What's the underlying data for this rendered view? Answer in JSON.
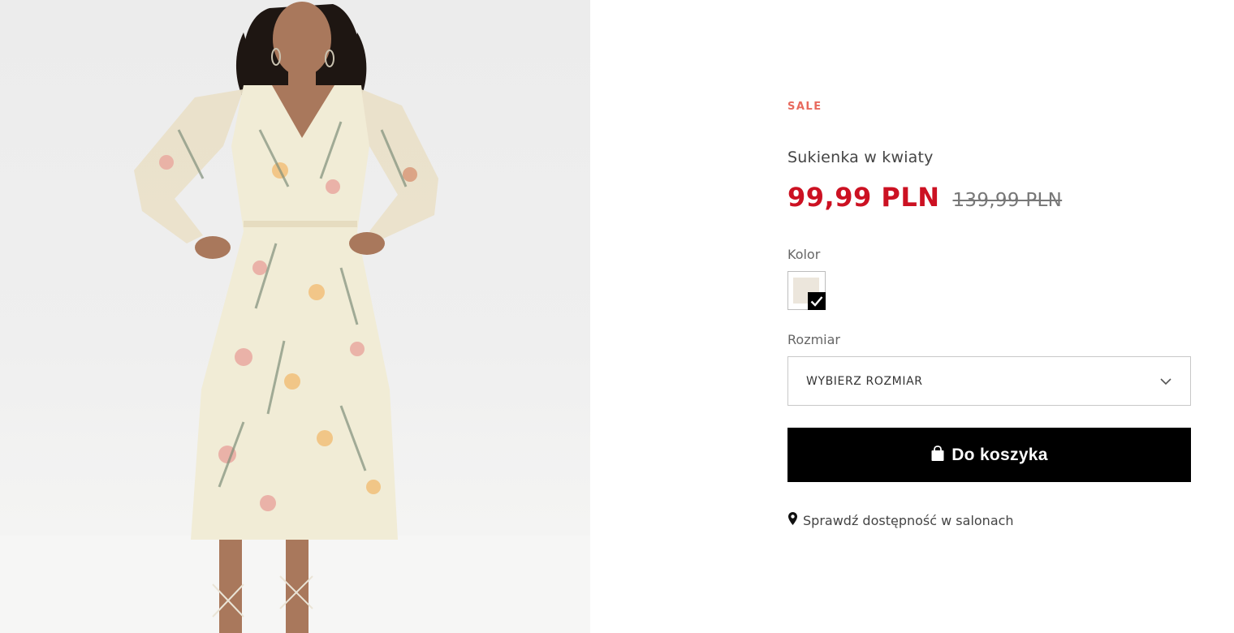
{
  "product": {
    "badge": "SALE",
    "title": "Sukienka w kwiaty",
    "price_current": "99,99 PLN",
    "price_old": "139,99 PLN"
  },
  "color": {
    "label": "Kolor",
    "swatch_hex": "#ece6dc",
    "selected": true
  },
  "size": {
    "label": "Rozmiar",
    "placeholder": "WYBIERZ ROZMIAR"
  },
  "cart": {
    "label": "Do koszyka",
    "icon": "shopping-bag-icon"
  },
  "store_check": {
    "label": "Sprawdź dostępność w salonach",
    "icon": "map-pin-icon"
  },
  "colors": {
    "sale": "#e86a5e",
    "price": "#cc1122",
    "button": "#000000"
  }
}
